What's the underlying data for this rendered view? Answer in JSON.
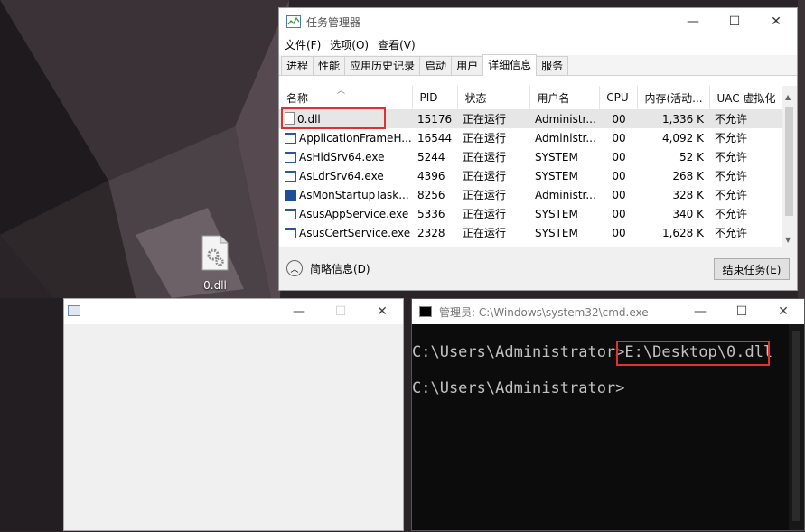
{
  "desktop": {
    "icon_label": "0.dll"
  },
  "taskmgr": {
    "title": "任务管理器",
    "menu": [
      "文件(F)",
      "选项(O)",
      "查看(V)"
    ],
    "tabs": [
      "进程",
      "性能",
      "应用历史记录",
      "启动",
      "用户",
      "详细信息",
      "服务"
    ],
    "active_tab": "详细信息",
    "columns": [
      "名称",
      "PID",
      "状态",
      "用户名",
      "CPU",
      "内存(活动...",
      "UAC 虚拟化"
    ],
    "rows": [
      {
        "icon": "file-icon",
        "name": "0.dll",
        "pid": "15176",
        "status": "正在运行",
        "user": "Administr...",
        "cpu": "00",
        "mem": "1,336 K",
        "uac": "不允许"
      },
      {
        "icon": "window-app-icon",
        "name": "ApplicationFrameH...",
        "pid": "16544",
        "status": "正在运行",
        "user": "Administr...",
        "cpu": "00",
        "mem": "4,092 K",
        "uac": "不允许"
      },
      {
        "icon": "window-app-icon",
        "name": "AsHidSrv64.exe",
        "pid": "5244",
        "status": "正在运行",
        "user": "SYSTEM",
        "cpu": "00",
        "mem": "52 K",
        "uac": "不允许"
      },
      {
        "icon": "window-app-icon",
        "name": "AsLdrSrv64.exe",
        "pid": "4396",
        "status": "正在运行",
        "user": "SYSTEM",
        "cpu": "00",
        "mem": "268 K",
        "uac": "不允许"
      },
      {
        "icon": "asus-icon",
        "name": "AsMonStartupTask...",
        "pid": "8256",
        "status": "正在运行",
        "user": "Administr...",
        "cpu": "00",
        "mem": "328 K",
        "uac": "不允许"
      },
      {
        "icon": "window-app-icon",
        "name": "AsusAppService.exe",
        "pid": "5336",
        "status": "正在运行",
        "user": "SYSTEM",
        "cpu": "00",
        "mem": "340 K",
        "uac": "不允许"
      },
      {
        "icon": "window-app-icon",
        "name": "AsusCertService.exe",
        "pid": "2328",
        "status": "正在运行",
        "user": "SYSTEM",
        "cpu": "00",
        "mem": "1,628 K",
        "uac": "不允许"
      }
    ],
    "fewer_details": "简略信息(D)",
    "end_task": "结束任务(E)"
  },
  "cmd": {
    "title": "管理员: C:\\Windows\\system32\\cmd.exe",
    "line1_prompt": "C:\\Users\\Administrator>",
    "line1_command": "E:\\Desktop\\0.dll",
    "line2_prompt": "C:\\Users\\Administrator>"
  },
  "colors": {
    "highlight_box": "#e03030",
    "console_bg": "#0c0c0c",
    "console_text": "#c0c0c0"
  }
}
